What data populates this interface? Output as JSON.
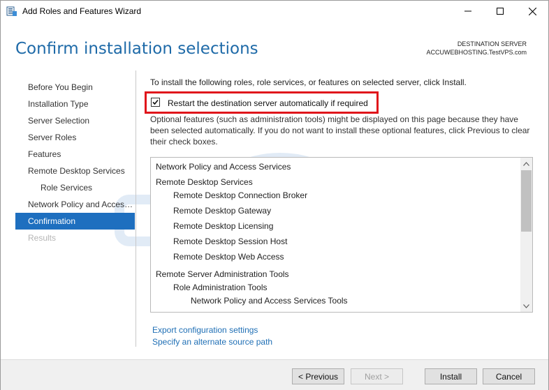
{
  "window": {
    "title": "Add Roles and Features Wizard"
  },
  "header": {
    "page_title": "Confirm installation selections",
    "destination_label": "DESTINATION SERVER",
    "destination_server": "ACCUWEBHOSTING.TestVPS.com"
  },
  "nav": {
    "items": [
      {
        "label": "Before You Begin"
      },
      {
        "label": "Installation Type"
      },
      {
        "label": "Server Selection"
      },
      {
        "label": "Server Roles"
      },
      {
        "label": "Features"
      },
      {
        "label": "Remote Desktop Services"
      },
      {
        "label": "Role Services"
      },
      {
        "label": "Network Policy and Access Services"
      },
      {
        "label": "Confirmation"
      },
      {
        "label": "Results"
      }
    ]
  },
  "main": {
    "intro": "To install the following roles, role services, or features on selected server, click Install.",
    "restart_label": "Restart the destination server automatically if required",
    "restart_checked": true,
    "optional_text": "Optional features (such as administration tools) might be displayed on this page because they have been selected automatically. If you do not want to install these optional features, click Previous to clear their check boxes.",
    "list": [
      {
        "label": "Network Policy and Access Services",
        "level": 0
      },
      {
        "label": "Remote Desktop Services",
        "level": 0
      },
      {
        "label": "Remote Desktop Connection Broker",
        "level": 1
      },
      {
        "label": "Remote Desktop Gateway",
        "level": 1
      },
      {
        "label": "Remote Desktop Licensing",
        "level": 1
      },
      {
        "label": "Remote Desktop Session Host",
        "level": 1
      },
      {
        "label": "Remote Desktop Web Access",
        "level": 1
      },
      {
        "label": "Remote Server Administration Tools",
        "level": 0
      },
      {
        "label": "Role Administration Tools",
        "level": 1
      },
      {
        "label": "Network Policy and Access Services Tools",
        "level": 2
      }
    ],
    "export_link": "Export configuration settings",
    "alt_source_link": "Specify an alternate source path"
  },
  "buttons": {
    "previous": "< Previous",
    "next": "Next >",
    "install": "Install",
    "cancel": "Cancel"
  },
  "colors": {
    "accent": "#1e6fbf",
    "title_blue": "#1e6aa8",
    "highlight_red": "#e0151b",
    "link_blue": "#1f6fb5"
  }
}
